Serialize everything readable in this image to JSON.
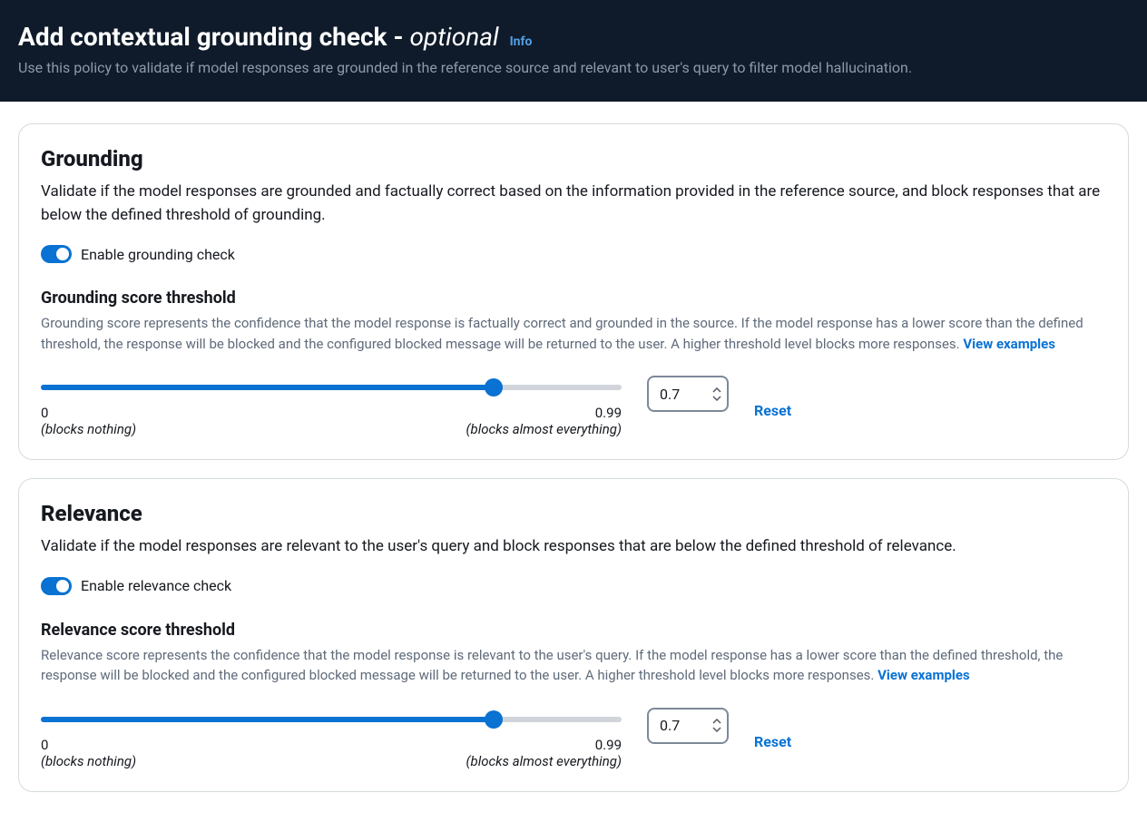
{
  "header": {
    "title_main": "Add contextual grounding check - ",
    "title_optional": "optional",
    "info_label": "Info",
    "description": "Use this policy to validate if model responses are grounded in the reference source and relevant to user's query to filter model hallucination."
  },
  "grounding": {
    "title": "Grounding",
    "description": "Validate if the model responses are grounded and factually correct based on the information provided in the reference source, and block responses that are below the defined threshold of grounding.",
    "toggle_label": "Enable grounding check",
    "threshold_title": "Grounding score threshold",
    "threshold_help": "Grounding score represents the confidence that the model response is factually correct and grounded in the source. If the model response has a lower score than the defined threshold, the response will be blocked and the configured blocked message will be returned to the user. A higher threshold level blocks more responses. ",
    "view_examples": "View examples",
    "slider_min": "0",
    "slider_min_sub": "(blocks nothing)",
    "slider_max": "0.99",
    "slider_max_sub": "(blocks almost everything)",
    "value": "0.7",
    "reset": "Reset"
  },
  "relevance": {
    "title": "Relevance",
    "description": "Validate if the model responses are relevant to the user's query and block responses that are below the defined threshold of relevance.",
    "toggle_label": "Enable relevance check",
    "threshold_title": "Relevance score threshold",
    "threshold_help": "Relevance score represents the confidence that the model response is relevant to the user's query. If the model response has a lower score than the defined threshold, the response will be blocked and the configured blocked message will be returned to the user. A higher threshold level blocks more responses.  ",
    "view_examples": "View examples",
    "slider_min": "0",
    "slider_min_sub": "(blocks nothing)",
    "slider_max": "0.99",
    "slider_max_sub": "(blocks almost everything)",
    "value": "0.7",
    "reset": "Reset"
  }
}
